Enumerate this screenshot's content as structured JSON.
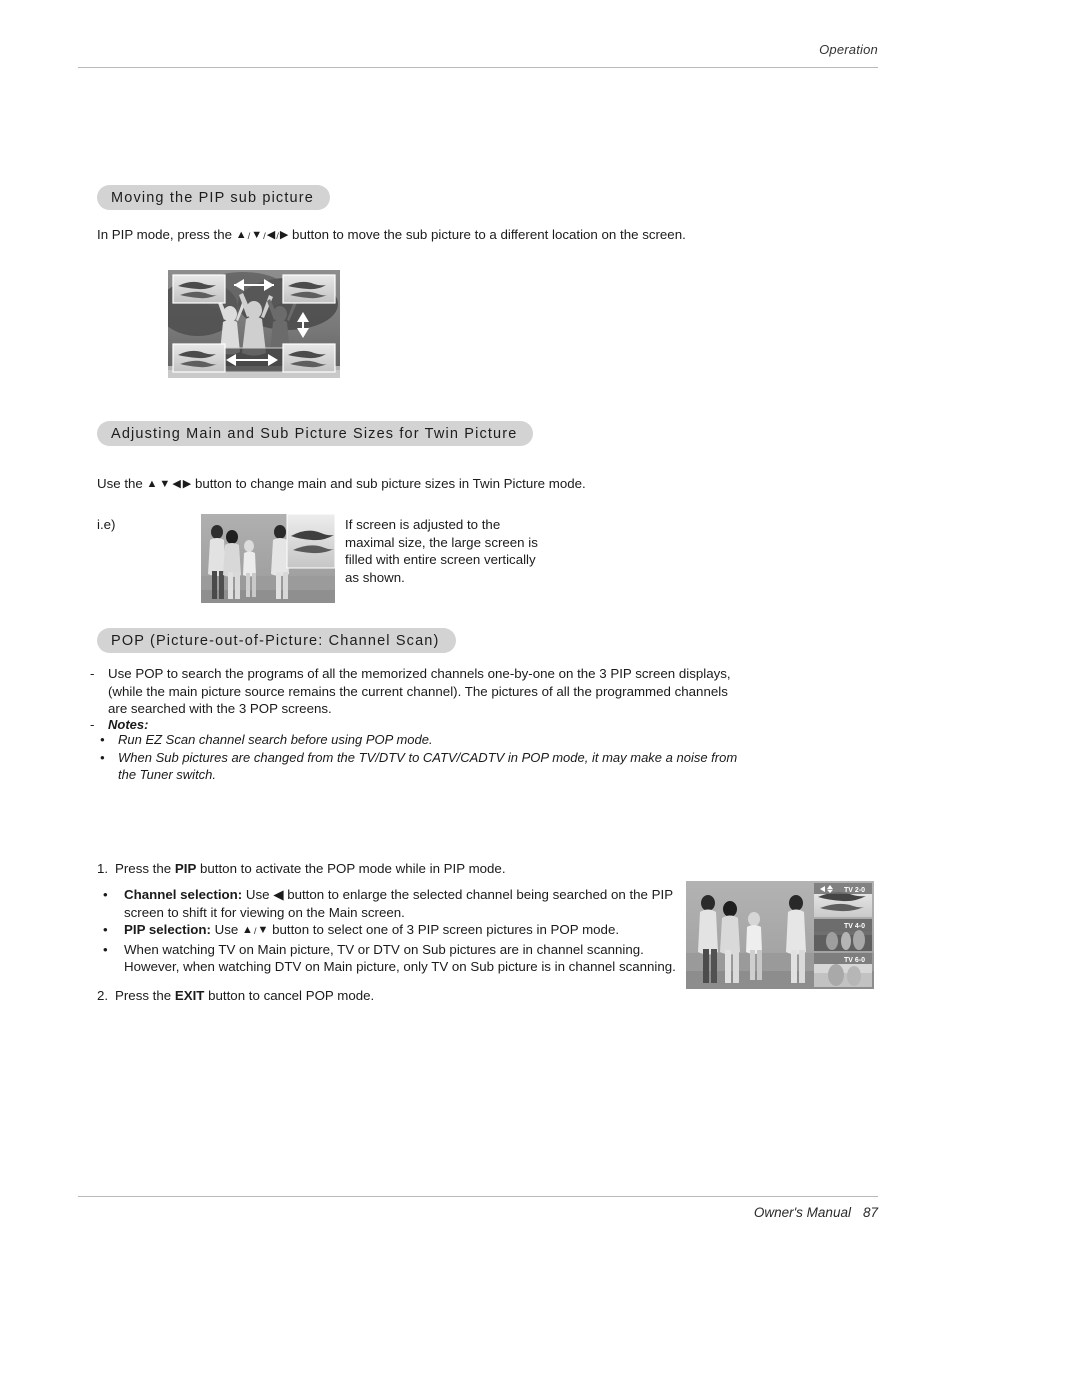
{
  "header": {
    "label": "Operation"
  },
  "footer": {
    "label": "Owner's Manual",
    "page": "87"
  },
  "sections": [
    {
      "heading": "Moving the PIP sub picture",
      "paragraph_before_arrows": "In PIP mode, press the ",
      "paragraph_after_arrows": " button to move the sub picture to a different location on the screen.",
      "arrows": [
        "▲",
        "▼",
        "◀",
        "▶"
      ],
      "arrow_separator": "/",
      "image_name": "pip-move-illustration"
    },
    {
      "heading": "Adjusting Main and Sub Picture Sizes for Twin Picture",
      "paragraph_before_arrows": "Use the ",
      "paragraph_after_arrows": " button to change main and sub picture sizes in Twin Picture mode.",
      "arrows": [
        "▲",
        "▼",
        "◀",
        "▶"
      ],
      "example_label": "i.e)",
      "caption": "If screen is adjusted to the maximal size, the large screen is filled with entire screen vertically as shown.",
      "image_name": "twin-picture-illustration"
    },
    {
      "heading": "POP (Picture-out-of-Picture: Channel Scan)",
      "dash": "-",
      "paragraph": "Use POP to search the programs of all the memorized channels one-by-one on the 3 PIP screen displays, (while the main picture source remains the current channel). The pictures of all the programmed channels are searched with the 3 POP screens.",
      "notes_title": "Notes:",
      "notes_bullet_char": "•",
      "notes": [
        "Run EZ Scan channel search before using POP mode.",
        "When Sub pictures are changed from the TV/DTV to CATV/CADTV in POP mode, it may make a noise from the Tuner switch."
      ]
    }
  ],
  "steps": {
    "step1_number": "1.",
    "step1_before_bold": "Press the ",
    "step1_bold": "PIP",
    "step1_after_bold": " button to activate the POP mode while in PIP mode.",
    "bullet_char": "•",
    "bullets": [
      {
        "bold": "Channel selection:",
        "text_before_arrow": " Use ",
        "arrow": "◀",
        "text_after_arrow": " button to enlarge the selected channel being searched on the PIP screen to shift it for viewing on the Main screen."
      },
      {
        "bold": "PIP selection:",
        "text_before_arrow": " Use ",
        "arrows": [
          "▲",
          "▼"
        ],
        "arrow_separator": "/",
        "text_after_arrow": " button to select one of 3 PIP screen pictures in POP mode."
      },
      {
        "bold": "",
        "text": "When watching TV on Main picture, TV or DTV on Sub pictures are in channel scanning. However, when watching DTV  on Main picture, only TV on Sub picture is in channel scanning."
      }
    ],
    "step2_number": "2.",
    "step2_before_bold": "Press the ",
    "step2_bold": "EXIT",
    "step2_after_bold": " button to cancel POP mode."
  },
  "pop_illustration": {
    "name": "pop-screen-illustration",
    "osd_left_arrow": "◀",
    "osd_updown": "↕",
    "sub_picture_labels": [
      "TV 2-0",
      "TV 4-0",
      "TV 6-0"
    ]
  },
  "colors": {
    "pill_background": "#d3d3d3",
    "rule": "#b9b9b9",
    "text": "#1b1b1b",
    "photo_sky": "#a9a9a9",
    "photo_dark": "#3c3c3c"
  }
}
